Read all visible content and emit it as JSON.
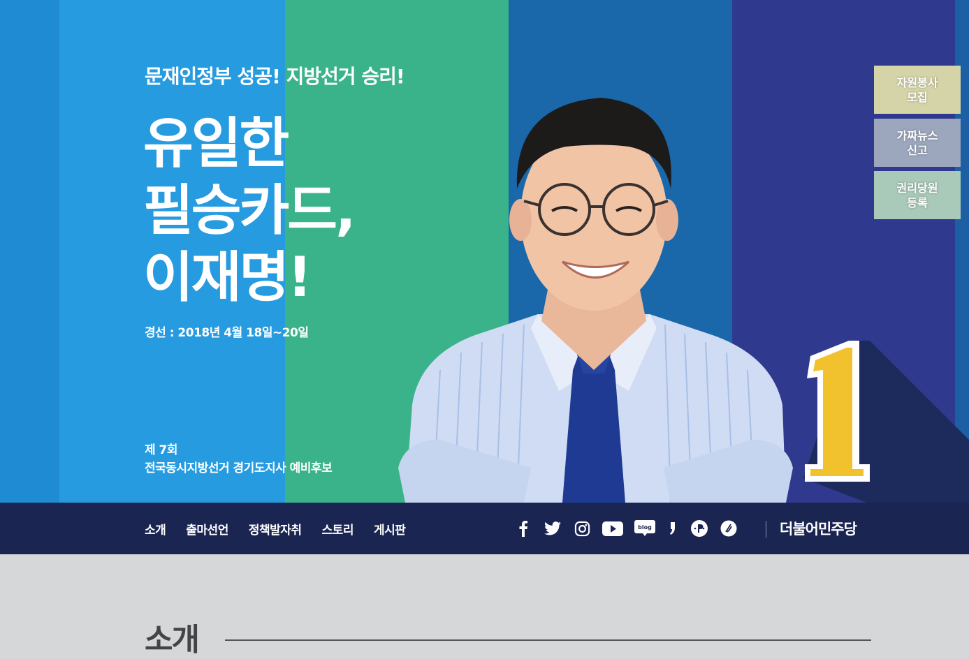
{
  "hero": {
    "slogan_top": "문재인정부 성공! 지방선거 승리!",
    "headline": [
      "유일한",
      "필승카드,",
      "이재명!"
    ],
    "election_date": "경선 : 2018년 4월 18일~20일",
    "candidate_info": [
      "제 7회",
      "전국동시지방선거 경기도지사 예비후보"
    ],
    "ballot_number": "1",
    "colors": {
      "blue": "#279be0",
      "green": "#3bb38a",
      "navy": "#2f3a8f",
      "gold": "#f2c12e"
    }
  },
  "side_buttons": [
    {
      "label": [
        "자원봉사",
        "모집"
      ]
    },
    {
      "label": [
        "가짜뉴스",
        "신고"
      ]
    },
    {
      "label": [
        "권리당원",
        "등록"
      ]
    }
  ],
  "nav": {
    "items": [
      "소개",
      "출마선언",
      "정책발자취",
      "스토리",
      "게시판"
    ],
    "social": [
      "facebook-icon",
      "twitter-icon",
      "instagram-icon",
      "youtube-icon",
      "blog-icon",
      "kakaostory-icon",
      "pinterest-icon",
      "brunch-icon"
    ],
    "party": "더불어민주당"
  },
  "section": {
    "title": "소개"
  }
}
